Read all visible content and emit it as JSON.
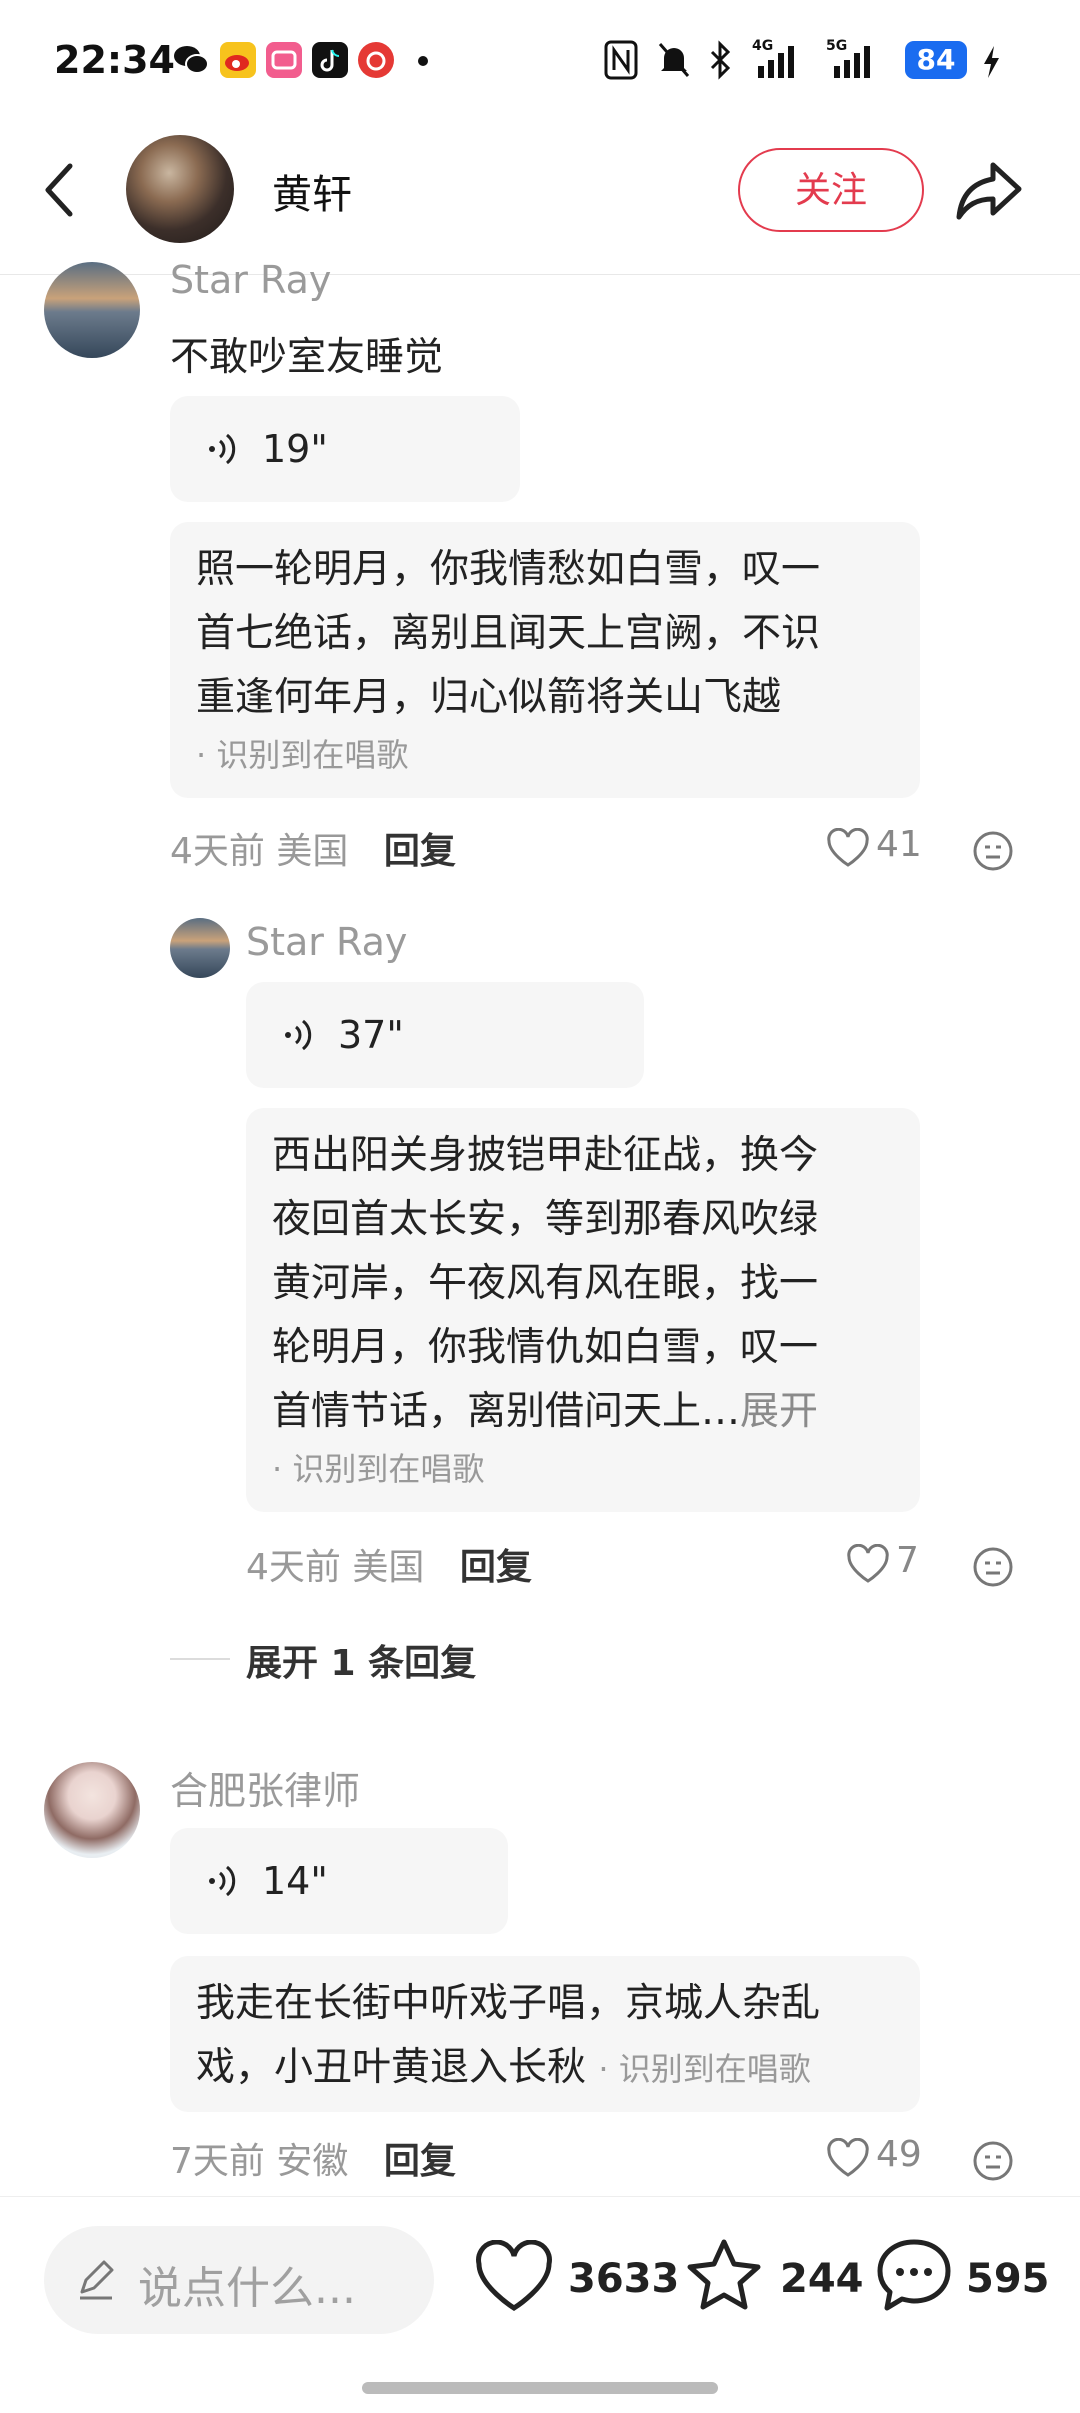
{
  "status_bar": {
    "time": "22:34",
    "battery": "84"
  },
  "header": {
    "title": "黄轩",
    "follow_label": "关注"
  },
  "comments": [
    {
      "user": "Star Ray",
      "text": "不敢吵室友睡觉",
      "voice_duration": "19\"",
      "lyrics": [
        "照一轮明月，你我情愁如白雪，叹一",
        "首七绝话，离别且闻天上宫阙，不识",
        "重逢何年月，归心似箭将关山飞越"
      ],
      "recognized": "· 识别到在唱歌",
      "time": "4天前",
      "location": "美国",
      "reply_label": "回复",
      "likes": "41"
    },
    {
      "user": "Star Ray",
      "voice_duration": "37\"",
      "lyrics": [
        "西出阳关身披铠甲赴征战，换今",
        "夜回首太长安，等到那春风吹绿",
        "黄河岸，午夜风有风在眼，找一",
        "轮明月，你我情仇如白雪，叹一",
        "首情节话，离别借问天上…"
      ],
      "expand_label": "展开",
      "recognized": "· 识别到在唱歌",
      "time": "4天前",
      "location": "美国",
      "reply_label": "回复",
      "likes": "7"
    },
    {
      "user": "合肥张律师",
      "voice_duration": "14\"",
      "lyrics": [
        "我走在长街中听戏子唱，京城人杂乱",
        "戏，小丑叶黄退入长秋"
      ],
      "recognized": "· 识别到在唱歌",
      "time": "7天前",
      "location": "安徽",
      "reply_label": "回复",
      "likes": "49"
    }
  ],
  "expand_replies_label": "展开 1 条回复",
  "bottom_bar": {
    "input_placeholder": "说点什么...",
    "likes": "3633",
    "stars": "244",
    "comments": "595"
  }
}
